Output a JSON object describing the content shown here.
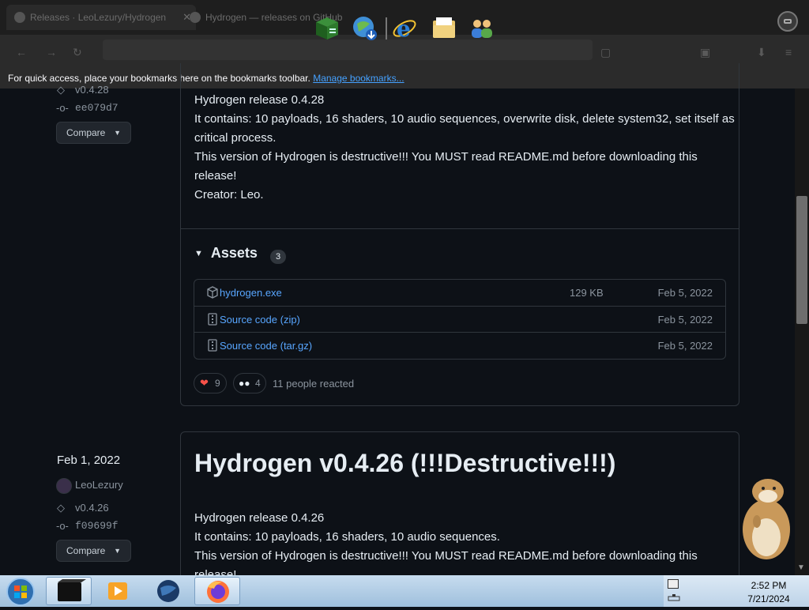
{
  "browser": {
    "tabs": [
      {
        "label": "Releases · LeoLezury/Hydrogen"
      },
      {
        "label": "Hydrogen — releases on GitHub"
      }
    ],
    "bookmarks_msg": "For quick access, place your bookmarks here on the bookmarks toolbar.",
    "manage_bookmarks": "Manage bookmarks..."
  },
  "release1": {
    "tag": "v0.4.28",
    "commit": "ee079d7",
    "compare_label": "Compare",
    "body_lines": [
      "Hydrogen release 0.4.28",
      "It contains: 10 payloads, 16 shaders, 10 audio sequences, overwrite disk, delete system32, set itself as critical process.",
      "This version of Hydrogen is destructive!!! You MUST read README.md before downloading this release!",
      "Creator: Leo."
    ],
    "assets_label": "Assets",
    "assets_count": "3",
    "assets": [
      {
        "name": "hydrogen.exe",
        "suffix": "",
        "size": "129 KB",
        "date": "Feb 5, 2022"
      },
      {
        "name": "Source code",
        "suffix": " (zip)",
        "size": "",
        "date": "Feb 5, 2022"
      },
      {
        "name": "Source code",
        "suffix": " (tar.gz)",
        "size": "",
        "date": "Feb 5, 2022"
      }
    ],
    "reactions": [
      {
        "emoji": "❤",
        "count": "9"
      },
      {
        "emoji": "👀",
        "count": "4"
      }
    ],
    "reacted_text": "11 people reacted"
  },
  "release2": {
    "date": "Feb 1, 2022",
    "author": "LeoLezury",
    "tag": "v0.4.26",
    "commit": "f09699f",
    "compare_label": "Compare",
    "title": "Hydrogen v0.4.26 (!!!Destructive!!!)",
    "body_lines": [
      "Hydrogen release 0.4.26",
      "It contains: 10 payloads, 16 shaders, 10 audio sequences.",
      "This version of Hydrogen is destructive!!! You MUST read README.md before downloading this release!"
    ]
  },
  "taskbar": {
    "time": "2:52 PM",
    "date": "7/21/2024"
  },
  "colors": {
    "link": "#4493f8",
    "bg": "#0d1117",
    "border": "#30363d"
  }
}
